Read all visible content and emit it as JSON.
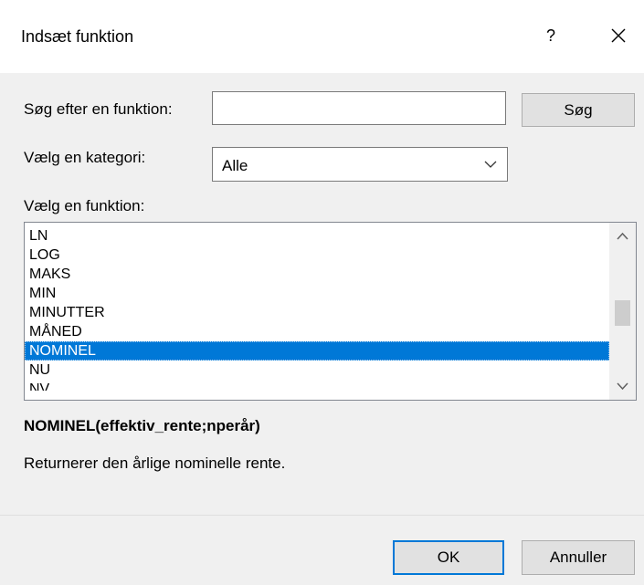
{
  "dialog": {
    "title": "Indsæt funktion",
    "help_label": "?"
  },
  "search": {
    "label": "Søg efter en funktion:",
    "value": "",
    "button_label": "Søg"
  },
  "category": {
    "label": "Vælg en kategori:",
    "selected": "Alle"
  },
  "function_list": {
    "label": "Vælg en funktion:",
    "items": [
      "LN",
      "LOG",
      "MAKS",
      "MIN",
      "MINUTTER",
      "MÅNED",
      "NOMINEL",
      "NU",
      "NV"
    ],
    "selected": "NOMINEL"
  },
  "details": {
    "syntax": "NOMINEL(effektiv_rente;nperår)",
    "description": "Returnerer den årlige nominelle rente."
  },
  "footer": {
    "ok_label": "OK",
    "cancel_label": "Annuller"
  },
  "colors": {
    "selection": "#0078d7",
    "default_button_border": "#0078d7"
  }
}
